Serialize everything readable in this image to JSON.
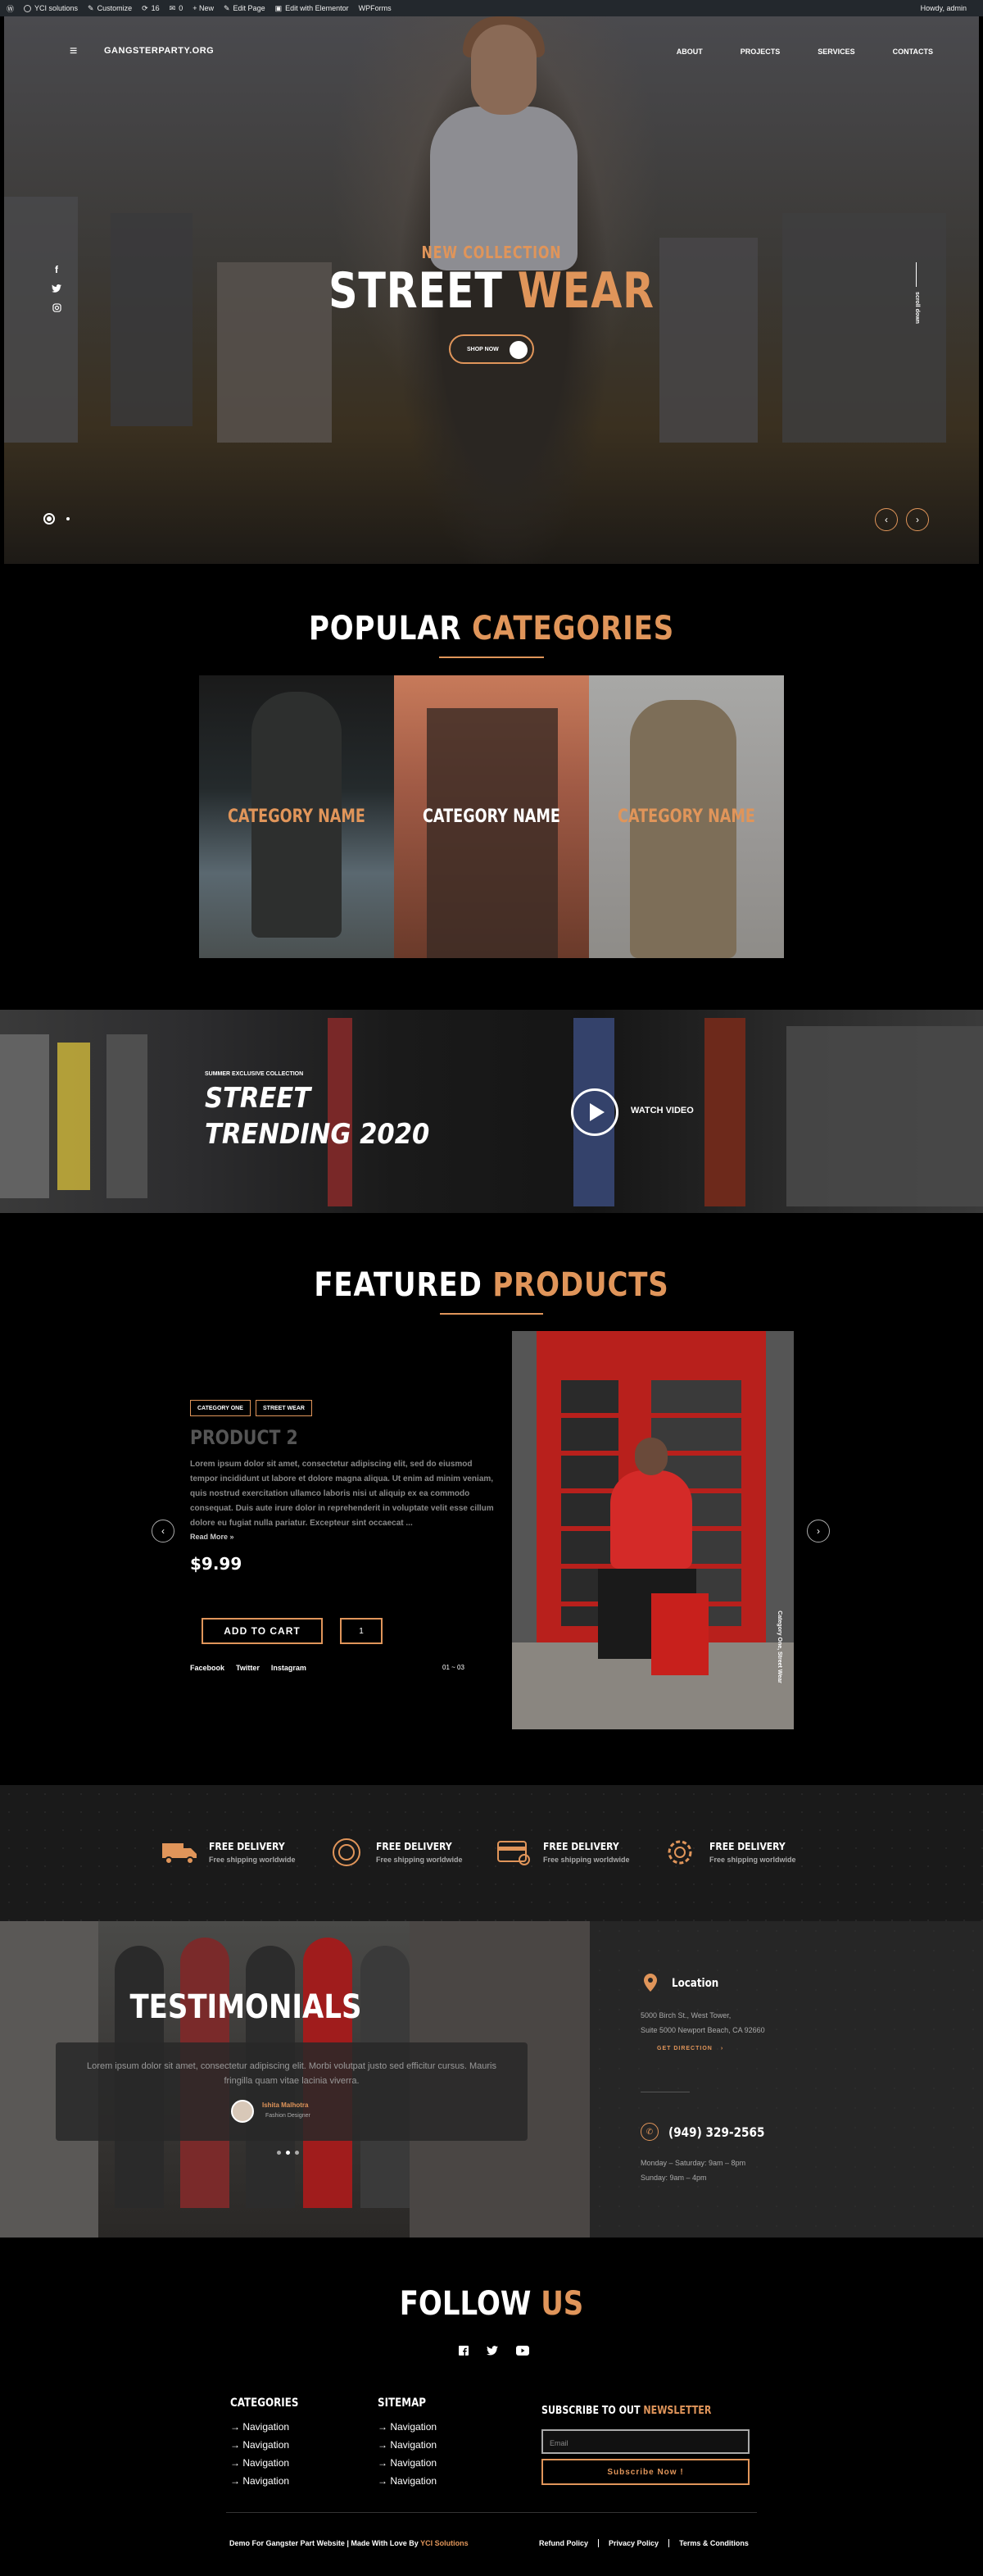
{
  "adminbar": {
    "items": [
      "YCI solutions",
      "Customize",
      "16",
      "0",
      "+ New",
      "Edit Page",
      "Edit with Elementor",
      "WPForms"
    ],
    "howdy": "Howdy, admin"
  },
  "nav": {
    "logo": "GANGSTERPARTY.ORG",
    "menu": [
      "ABOUT",
      "PROJECTS",
      "SERVICES",
      "CONTACTS"
    ]
  },
  "hero": {
    "subtitle": "NEW COLLECTION",
    "title_a": "STREET",
    "title_b": "WEAR",
    "button": "SHOP NOW",
    "side_text": "scroll down",
    "socials": [
      "facebook-icon",
      "twitter-icon",
      "instagram-icon"
    ]
  },
  "categories": {
    "title_a": "POPULAR",
    "title_b": "CATEGORIES",
    "items": [
      "CATEGORY NAME",
      "CATEGORY NAME",
      "CATEGORY NAME"
    ]
  },
  "trending": {
    "small": "SUMMER EXCLUSIVE COLLECTION",
    "line1": "STREET",
    "line2": "TRENDING 2020",
    "video": "WATCH VIDEO"
  },
  "featured": {
    "title_a": "FEATURED",
    "title_b": "PRODUCTS",
    "tags": [
      "CATEGORY ONE",
      "STREET WEAR"
    ],
    "name": "PRODUCT 2",
    "desc": "Lorem ipsum dolor sit amet, consectetur adipiscing elit, sed do eiusmod tempor incididunt ut labore et dolore magna aliqua. Ut enim ad minim veniam, quis nostrud exercitation ullamco laboris nisi ut aliquip ex ea commodo consequat. Duis aute irure dolor in reprehenderit in voluptate velit esse cillum dolore eu fugiat nulla pariatur. Excepteur sint occaecat ...",
    "readmore": "Read More »",
    "price": "$9.99",
    "cart": "ADD TO CART",
    "qty": "1",
    "socials": [
      "Facebook",
      "Twitter",
      "Instagram"
    ],
    "extra": "01 ~ 03",
    "img_label": "Category One, Street Wear"
  },
  "features": [
    {
      "icon": "truck-icon",
      "title": "FREE DELIVERY",
      "sub": "Free shipping worldwide"
    },
    {
      "icon": "badge-icon",
      "title": "FREE DELIVERY",
      "sub": "Free shipping worldwide"
    },
    {
      "icon": "card-icon",
      "title": "FREE DELIVERY",
      "sub": "Free shipping worldwide"
    },
    {
      "icon": "gear-icon",
      "title": "FREE DELIVERY",
      "sub": "Free shipping worldwide"
    }
  ],
  "testimonials": {
    "title": "TESTIMONIALS",
    "text": "Lorem ipsum dolor sit amet, consectetur adipiscing elit. Morbi volutpat justo sed efficitur cursus. Mauris fringilla quam vitae lacinia viverra.",
    "name": "Ishita Malhotra",
    "role": "Fashion Designer"
  },
  "contact": {
    "location_title": "Location",
    "addr1": "5000 Birch St., West Tower,",
    "addr2": "Suite 5000 Newport Beach, CA 92660",
    "direction": "GET DIRECTION",
    "phone": "(949) 329-2565",
    "hours1": "Monday – Saturday: 9am – 8pm",
    "hours2": "Sunday: 9am – 4pm"
  },
  "follow": {
    "title_a": "FOLLOW",
    "title_b": "US",
    "icons": [
      "facebook-icon",
      "twitter-icon",
      "youtube-icon"
    ]
  },
  "footer": {
    "categories_title": "CATEGORIES",
    "categories": [
      "→ Navigation",
      "→ Navigation",
      "→ Navigation",
      "→ Navigation"
    ],
    "sitemap_title": "SITEMAP",
    "sitemap": [
      "→ Navigation",
      "→ Navigation",
      "→ Navigation",
      "→ Navigation"
    ],
    "subscribe_a": "SUBSCRIBE TO OUT",
    "subscribe_b": "NEWSLETTER",
    "email_placeholder": "Email",
    "subscribe_btn": "Subscribe Now !",
    "copy_a": "Demo For Gangster Part Website | Made With Love By",
    "copy_b": "YCI Solutions",
    "policies": [
      "Refund Policy",
      "Privacy Policy",
      "Terms & Conditions"
    ]
  },
  "colors": {
    "accent": "#e0955a",
    "bg": "#000000"
  }
}
